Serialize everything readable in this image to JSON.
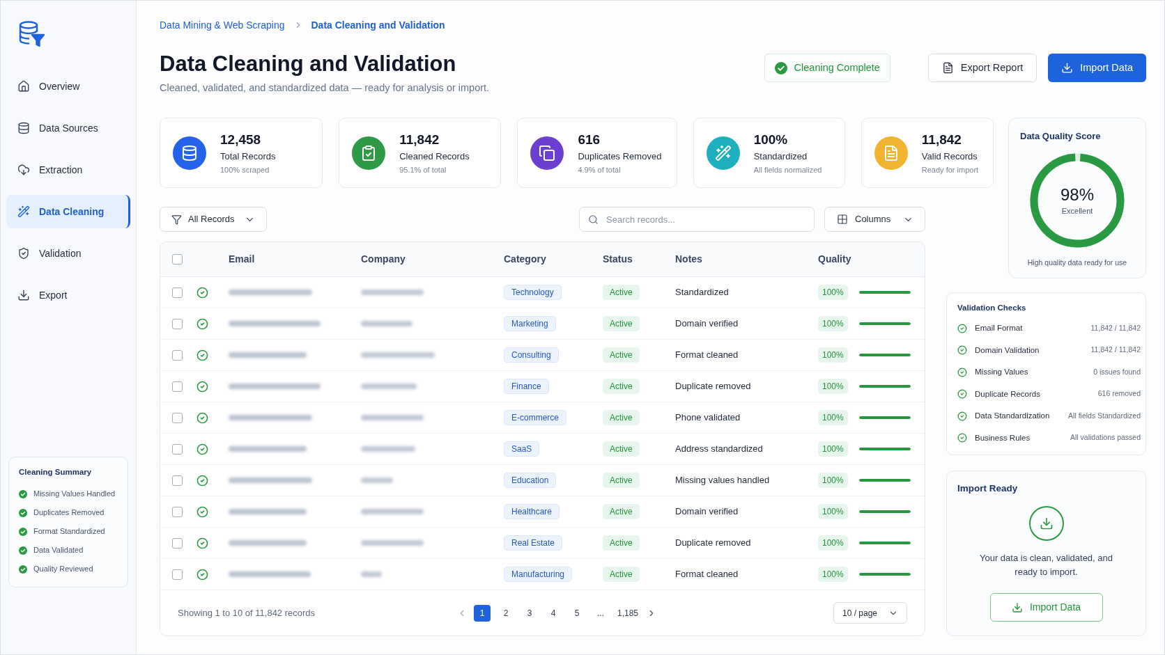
{
  "sidebar": {
    "nav": [
      {
        "label": "Overview",
        "selected": false
      },
      {
        "label": "Data Sources",
        "selected": false
      },
      {
        "label": "Extraction",
        "selected": false
      },
      {
        "label": "Data Cleaning",
        "selected": true
      },
      {
        "label": "Validation",
        "selected": false
      },
      {
        "label": "Export",
        "selected": false
      }
    ],
    "cleaning_summary": {
      "title": "Cleaning Summary",
      "items": [
        {
          "label": "Missing Values Handled",
          "done": true
        },
        {
          "label": "Duplicates Removed",
          "done": true
        },
        {
          "label": "Format Standardized",
          "done": true
        },
        {
          "label": "Data Validated",
          "done": true
        },
        {
          "label": "Quality Reviewed",
          "done": true
        }
      ]
    }
  },
  "breadcrumb": [
    {
      "label": "Data Mining & Web Scraping",
      "current": false
    },
    {
      "label": "Data Cleaning and Validation",
      "current": true
    }
  ],
  "header": {
    "title": "Data Cleaning and Validation",
    "subtitle": "Cleaned, validated, and standardized data — ready for analysis or import.",
    "status_badge": "Cleaning Complete",
    "buttons": [
      {
        "label": "Export Report",
        "kind": "secondary"
      },
      {
        "label": "Import Data",
        "kind": "primary"
      }
    ]
  },
  "stats": [
    {
      "value": "12,458",
      "label": "Total Records",
      "note": "100% scraped",
      "color": "#2563eb"
    },
    {
      "value": "11,842",
      "label": "Cleaned Records",
      "note": "95.1% of total",
      "color": "#2f9a45"
    },
    {
      "value": "616",
      "label": "Duplicates Removed",
      "note": "4.9% of total",
      "color": "#6b3fcf"
    },
    {
      "value": "100%",
      "label": "Standardized",
      "note": "All fields normalized",
      "color": "#1eb1bd"
    },
    {
      "value": "11,842",
      "label": "Valid Records",
      "note": "Ready for import",
      "color": "#f0b430"
    }
  ],
  "quality_score": {
    "title": "Data Quality Score",
    "value": "98%",
    "rating": "Excellent",
    "level": 0.98,
    "caption": "High quality data ready for use"
  },
  "toolbar": {
    "filter": "All Records",
    "search": {
      "placeholder": "Search records..."
    },
    "columns_button": "Columns"
  },
  "table": {
    "header_checked": false,
    "columns": [
      "Email",
      "Company",
      "Category",
      "Status",
      "Notes",
      "Quality"
    ],
    "rows": [
      {
        "checked": false,
        "valid": true,
        "category": "Technology",
        "status": "Active",
        "notes": "Standardized",
        "quality": "100%",
        "level": 1
      },
      {
        "checked": false,
        "valid": true,
        "category": "Marketing",
        "status": "Active",
        "notes": "Domain verified",
        "quality": "100%",
        "level": 1
      },
      {
        "checked": false,
        "valid": true,
        "category": "Consulting",
        "status": "Active",
        "notes": "Format cleaned",
        "quality": "100%",
        "level": 1
      },
      {
        "checked": false,
        "valid": true,
        "category": "Finance",
        "status": "Active",
        "notes": "Duplicate removed",
        "quality": "100%",
        "level": 1
      },
      {
        "checked": false,
        "valid": true,
        "category": "E-commerce",
        "status": "Active",
        "notes": "Phone validated",
        "quality": "100%",
        "level": 1
      },
      {
        "checked": false,
        "valid": true,
        "category": "SaaS",
        "status": "Active",
        "notes": "Address standardized",
        "quality": "100%",
        "level": 1
      },
      {
        "checked": false,
        "valid": true,
        "category": "Education",
        "status": "Active",
        "notes": "Missing values handled",
        "quality": "100%",
        "level": 1
      },
      {
        "checked": false,
        "valid": true,
        "category": "Healthcare",
        "status": "Active",
        "notes": "Domain verified",
        "quality": "100%",
        "level": 1
      },
      {
        "checked": false,
        "valid": true,
        "category": "Real Estate",
        "status": "Active",
        "notes": "Duplicate removed",
        "quality": "100%",
        "level": 1
      },
      {
        "checked": false,
        "valid": true,
        "category": "Manufacturing",
        "status": "Active",
        "notes": "Format cleaned",
        "quality": "100%",
        "level": 1
      }
    ],
    "footer": {
      "summary": "Showing 1 to 10 of 11,842 records",
      "pages": [
        {
          "label": "1",
          "selected": true
        },
        {
          "label": "2",
          "selected": false
        },
        {
          "label": "3",
          "selected": false
        },
        {
          "label": "4",
          "selected": false
        },
        {
          "label": "5",
          "selected": false
        },
        {
          "label": "...",
          "selected": false
        },
        {
          "label": "1,185",
          "selected": false
        }
      ],
      "page_size": "10 / page"
    }
  },
  "validation_checks": {
    "title": "Validation Checks",
    "items": [
      {
        "label": "Email Format",
        "value": "11,842 / 11,842",
        "passed": true
      },
      {
        "label": "Domain Validation",
        "value": "11,842 / 11,842",
        "passed": true
      },
      {
        "label": "Missing Values",
        "value": "0 issues found",
        "passed": true
      },
      {
        "label": "Duplicate Records",
        "value": "616 removed",
        "passed": true
      },
      {
        "label": "Data Standardization",
        "value": "All fields Standardized",
        "passed": true
      },
      {
        "label": "Business Rules",
        "value": "All validations passed",
        "passed": true
      }
    ]
  },
  "import_ready": {
    "title": "Import Ready",
    "message": "Your data is clean, validated, and ready to import.",
    "button": "Import Data"
  }
}
